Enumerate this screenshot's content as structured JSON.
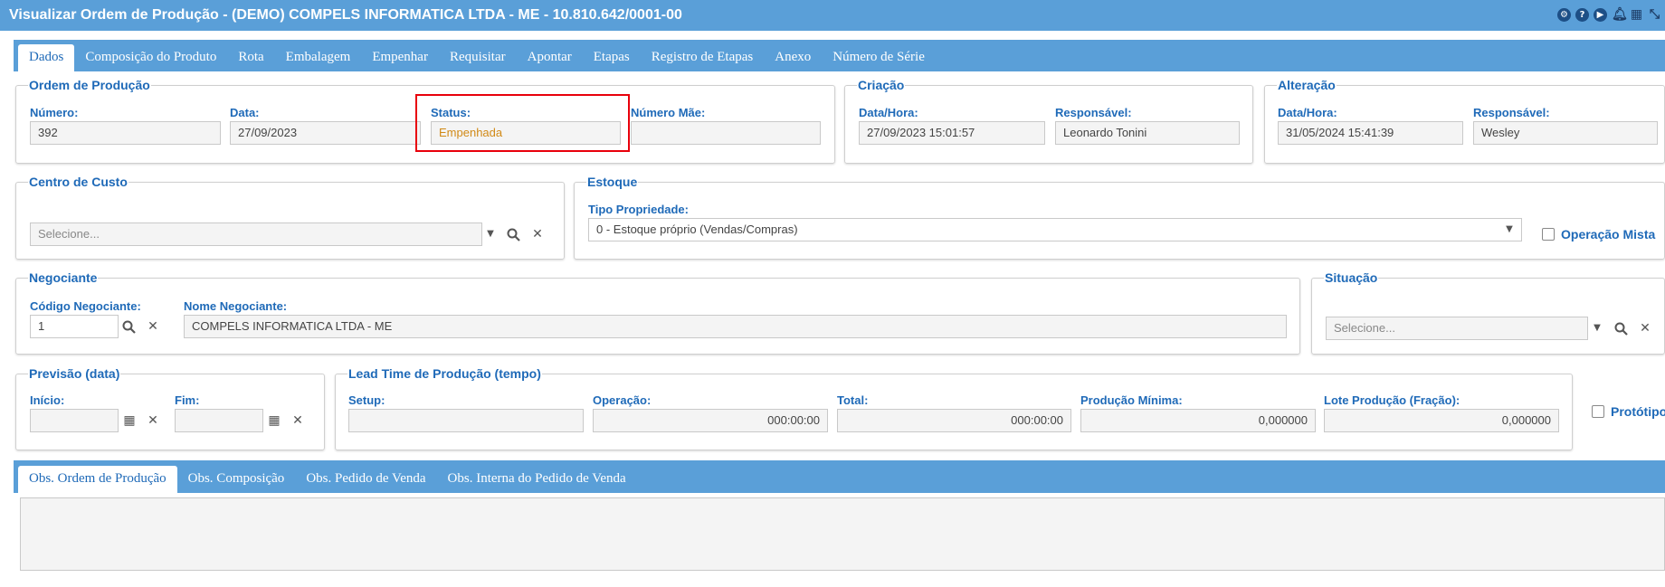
{
  "window": {
    "title": "Visualizar Ordem de Produção - (DEMO) COMPELS INFORMATICA LTDA - ME - 10.810.642/0001-00",
    "icons": [
      "settings-icon",
      "help-icon",
      "play-icon",
      "bell-icon",
      "calendar-icon",
      "collapse-icon"
    ]
  },
  "tabs": [
    {
      "label": "Dados",
      "active": true
    },
    {
      "label": "Composição do Produto"
    },
    {
      "label": "Rota"
    },
    {
      "label": "Embalagem"
    },
    {
      "label": "Empenhar"
    },
    {
      "label": "Requisitar"
    },
    {
      "label": "Apontar"
    },
    {
      "label": "Etapas"
    },
    {
      "label": "Registro de Etapas"
    },
    {
      "label": "Anexo"
    },
    {
      "label": "Número de Série"
    }
  ],
  "ordem": {
    "legend": "Ordem de Produção",
    "numero_label": "Número:",
    "numero": "392",
    "data_label": "Data:",
    "data": "27/09/2023",
    "status_label": "Status:",
    "status": "Empenhada",
    "numero_mae_label": "Número Mãe:",
    "numero_mae": ""
  },
  "criacao": {
    "legend": "Criação",
    "datahora_label": "Data/Hora:",
    "datahora": "27/09/2023 15:01:57",
    "responsavel_label": "Responsável:",
    "responsavel": "Leonardo Tonini"
  },
  "alteracao": {
    "legend": "Alteração",
    "datahora_label": "Data/Hora:",
    "datahora": "31/05/2024 15:41:39",
    "responsavel_label": "Responsável:",
    "responsavel": "Wesley"
  },
  "centro_custo": {
    "legend": "Centro de Custo",
    "placeholder": "Selecione..."
  },
  "estoque": {
    "legend": "Estoque",
    "tipo_label": "Tipo Propriedade:",
    "tipo_value": "0 - Estoque próprio (Vendas/Compras)",
    "operacao_mista_label": "Operação Mista",
    "operacao_mista": false
  },
  "negociante": {
    "legend": "Negociante",
    "codigo_label": "Código Negociante:",
    "codigo": "1",
    "nome_label": "Nome Negociante:",
    "nome": "COMPELS INFORMATICA LTDA - ME"
  },
  "situacao": {
    "legend": "Situação",
    "placeholder": "Selecione..."
  },
  "previsao": {
    "legend": "Previsão (data)",
    "inicio_label": "Início:",
    "inicio": "",
    "fim_label": "Fim:",
    "fim": ""
  },
  "lead_time": {
    "legend": "Lead Time de Produção (tempo)",
    "setup_label": "Setup:",
    "setup": "",
    "operacao_label": "Operação:",
    "operacao": "000:00:00",
    "total_label": "Total:",
    "total": "000:00:00",
    "producao_minima_label": "Produção Mínima:",
    "producao_minima": "0,000000",
    "lote_label": "Lote Produção (Fração):",
    "lote": "0,000000"
  },
  "prototipo": {
    "label": "Protótipo",
    "checked": false
  },
  "obs_tabs": [
    {
      "label": "Obs. Ordem de Produção",
      "active": true
    },
    {
      "label": "Obs. Composição"
    },
    {
      "label": "Obs. Pedido de Venda"
    },
    {
      "label": "Obs. Interna do Pedido de Venda"
    }
  ],
  "obs_text": ""
}
